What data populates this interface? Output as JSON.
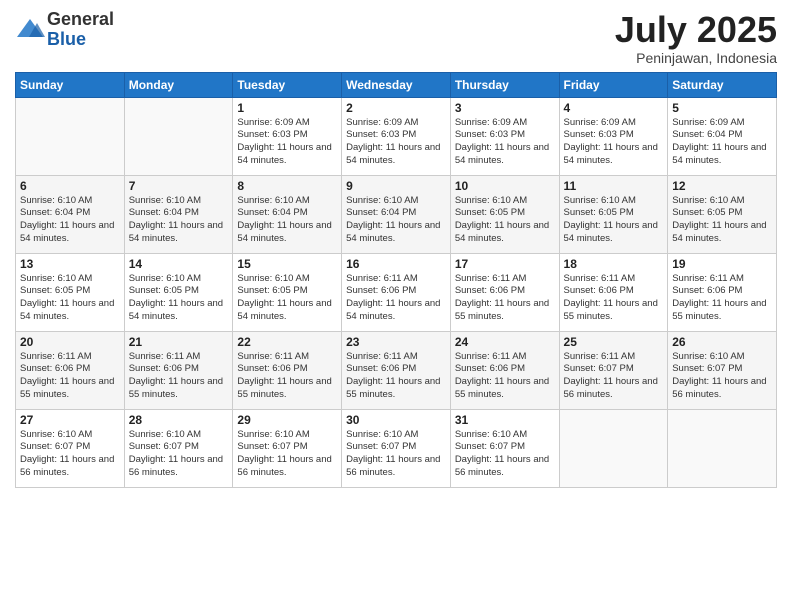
{
  "logo": {
    "general": "General",
    "blue": "Blue"
  },
  "title": "July 2025",
  "location": "Peninjawan, Indonesia",
  "days_of_week": [
    "Sunday",
    "Monday",
    "Tuesday",
    "Wednesday",
    "Thursday",
    "Friday",
    "Saturday"
  ],
  "weeks": [
    [
      {
        "day": "",
        "info": ""
      },
      {
        "day": "",
        "info": ""
      },
      {
        "day": "1",
        "info": "Sunrise: 6:09 AM\nSunset: 6:03 PM\nDaylight: 11 hours and 54 minutes."
      },
      {
        "day": "2",
        "info": "Sunrise: 6:09 AM\nSunset: 6:03 PM\nDaylight: 11 hours and 54 minutes."
      },
      {
        "day": "3",
        "info": "Sunrise: 6:09 AM\nSunset: 6:03 PM\nDaylight: 11 hours and 54 minutes."
      },
      {
        "day": "4",
        "info": "Sunrise: 6:09 AM\nSunset: 6:03 PM\nDaylight: 11 hours and 54 minutes."
      },
      {
        "day": "5",
        "info": "Sunrise: 6:09 AM\nSunset: 6:04 PM\nDaylight: 11 hours and 54 minutes."
      }
    ],
    [
      {
        "day": "6",
        "info": "Sunrise: 6:10 AM\nSunset: 6:04 PM\nDaylight: 11 hours and 54 minutes."
      },
      {
        "day": "7",
        "info": "Sunrise: 6:10 AM\nSunset: 6:04 PM\nDaylight: 11 hours and 54 minutes."
      },
      {
        "day": "8",
        "info": "Sunrise: 6:10 AM\nSunset: 6:04 PM\nDaylight: 11 hours and 54 minutes."
      },
      {
        "day": "9",
        "info": "Sunrise: 6:10 AM\nSunset: 6:04 PM\nDaylight: 11 hours and 54 minutes."
      },
      {
        "day": "10",
        "info": "Sunrise: 6:10 AM\nSunset: 6:05 PM\nDaylight: 11 hours and 54 minutes."
      },
      {
        "day": "11",
        "info": "Sunrise: 6:10 AM\nSunset: 6:05 PM\nDaylight: 11 hours and 54 minutes."
      },
      {
        "day": "12",
        "info": "Sunrise: 6:10 AM\nSunset: 6:05 PM\nDaylight: 11 hours and 54 minutes."
      }
    ],
    [
      {
        "day": "13",
        "info": "Sunrise: 6:10 AM\nSunset: 6:05 PM\nDaylight: 11 hours and 54 minutes."
      },
      {
        "day": "14",
        "info": "Sunrise: 6:10 AM\nSunset: 6:05 PM\nDaylight: 11 hours and 54 minutes."
      },
      {
        "day": "15",
        "info": "Sunrise: 6:10 AM\nSunset: 6:05 PM\nDaylight: 11 hours and 54 minutes."
      },
      {
        "day": "16",
        "info": "Sunrise: 6:11 AM\nSunset: 6:06 PM\nDaylight: 11 hours and 54 minutes."
      },
      {
        "day": "17",
        "info": "Sunrise: 6:11 AM\nSunset: 6:06 PM\nDaylight: 11 hours and 55 minutes."
      },
      {
        "day": "18",
        "info": "Sunrise: 6:11 AM\nSunset: 6:06 PM\nDaylight: 11 hours and 55 minutes."
      },
      {
        "day": "19",
        "info": "Sunrise: 6:11 AM\nSunset: 6:06 PM\nDaylight: 11 hours and 55 minutes."
      }
    ],
    [
      {
        "day": "20",
        "info": "Sunrise: 6:11 AM\nSunset: 6:06 PM\nDaylight: 11 hours and 55 minutes."
      },
      {
        "day": "21",
        "info": "Sunrise: 6:11 AM\nSunset: 6:06 PM\nDaylight: 11 hours and 55 minutes."
      },
      {
        "day": "22",
        "info": "Sunrise: 6:11 AM\nSunset: 6:06 PM\nDaylight: 11 hours and 55 minutes."
      },
      {
        "day": "23",
        "info": "Sunrise: 6:11 AM\nSunset: 6:06 PM\nDaylight: 11 hours and 55 minutes."
      },
      {
        "day": "24",
        "info": "Sunrise: 6:11 AM\nSunset: 6:06 PM\nDaylight: 11 hours and 55 minutes."
      },
      {
        "day": "25",
        "info": "Sunrise: 6:11 AM\nSunset: 6:07 PM\nDaylight: 11 hours and 56 minutes."
      },
      {
        "day": "26",
        "info": "Sunrise: 6:10 AM\nSunset: 6:07 PM\nDaylight: 11 hours and 56 minutes."
      }
    ],
    [
      {
        "day": "27",
        "info": "Sunrise: 6:10 AM\nSunset: 6:07 PM\nDaylight: 11 hours and 56 minutes."
      },
      {
        "day": "28",
        "info": "Sunrise: 6:10 AM\nSunset: 6:07 PM\nDaylight: 11 hours and 56 minutes."
      },
      {
        "day": "29",
        "info": "Sunrise: 6:10 AM\nSunset: 6:07 PM\nDaylight: 11 hours and 56 minutes."
      },
      {
        "day": "30",
        "info": "Sunrise: 6:10 AM\nSunset: 6:07 PM\nDaylight: 11 hours and 56 minutes."
      },
      {
        "day": "31",
        "info": "Sunrise: 6:10 AM\nSunset: 6:07 PM\nDaylight: 11 hours and 56 minutes."
      },
      {
        "day": "",
        "info": ""
      },
      {
        "day": "",
        "info": ""
      }
    ]
  ]
}
